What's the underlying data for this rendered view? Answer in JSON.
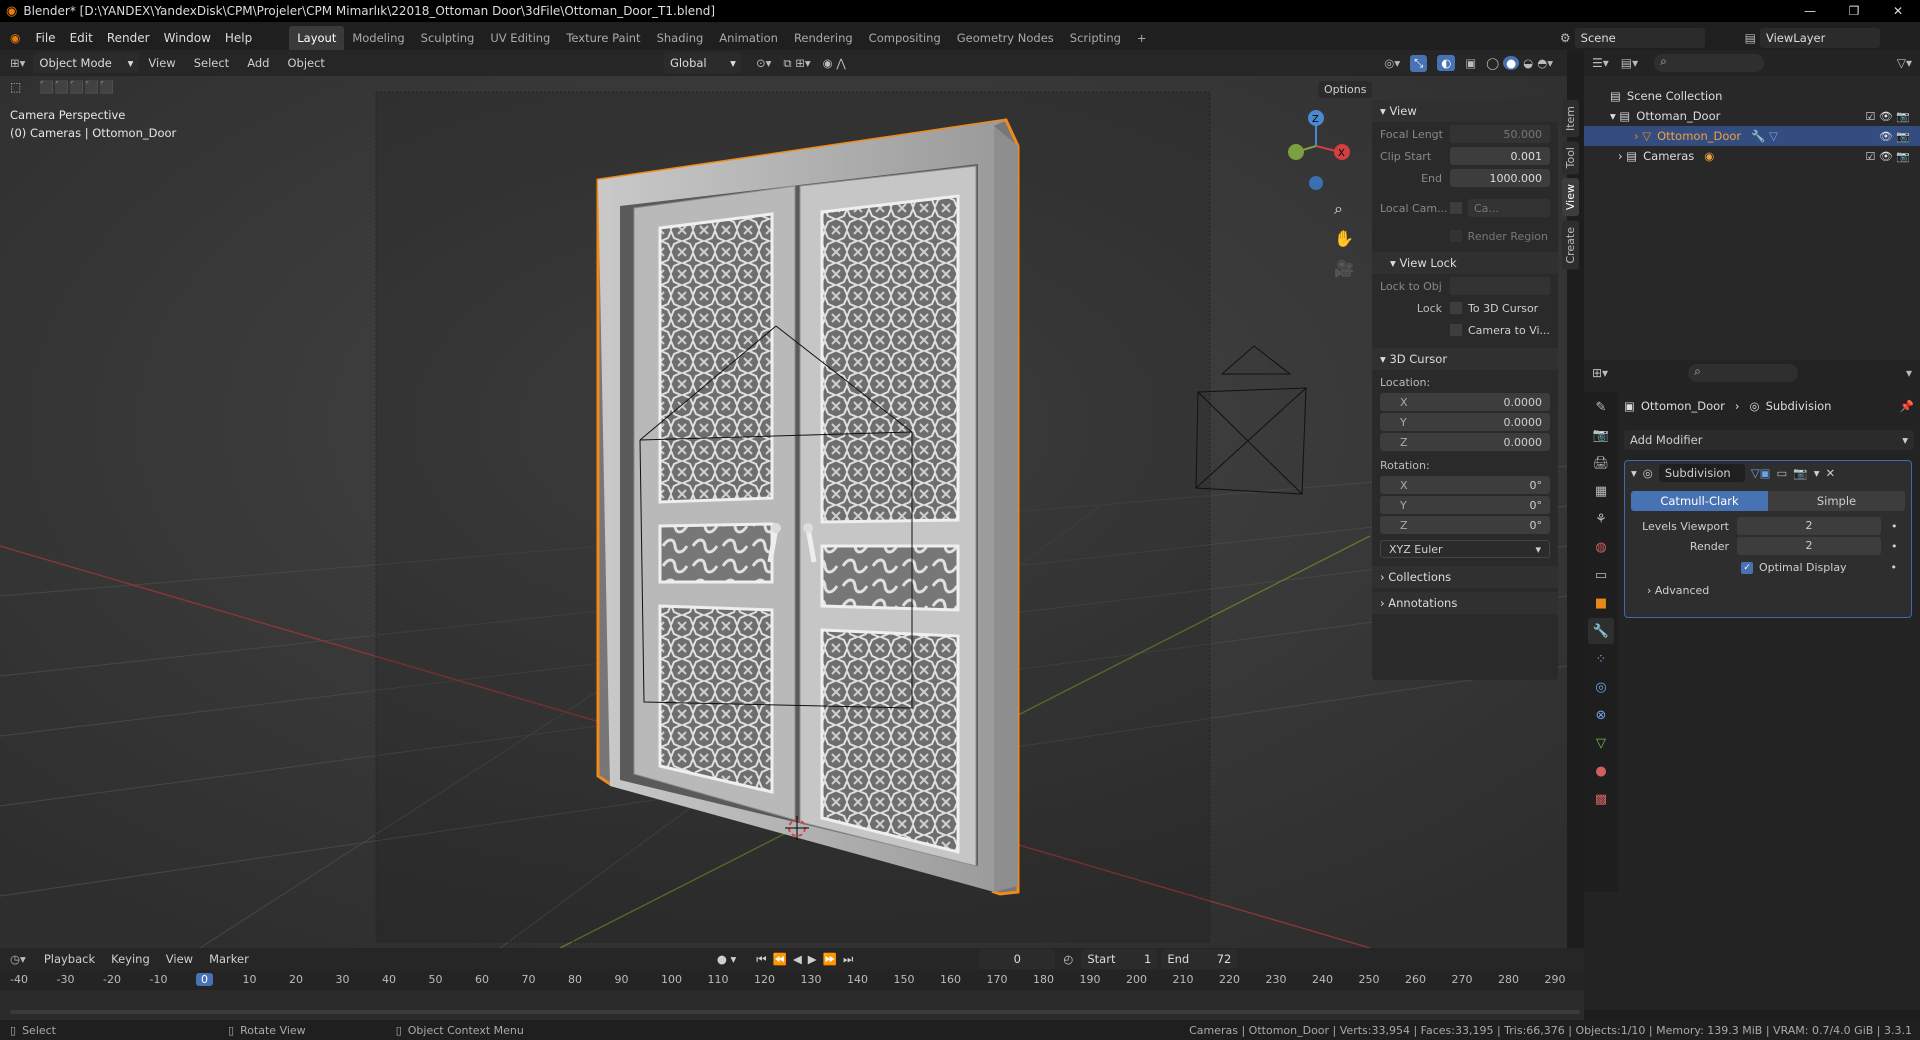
{
  "title": "Blender* [D:\\YANDEX\\YandexDisk\\CPM\\Projeler\\CPM Mimarlık\\22018_Ottoman Door\\3dFile\\Ottoman_Door_T1.blend]",
  "window_controls": [
    "—",
    "❐",
    "✕"
  ],
  "menus": [
    "File",
    "Edit",
    "Render",
    "Window",
    "Help"
  ],
  "workspaces": [
    "Layout",
    "Modeling",
    "Sculpting",
    "UV Editing",
    "Texture Paint",
    "Shading",
    "Animation",
    "Rendering",
    "Compositing",
    "Geometry Nodes",
    "Scripting",
    "+"
  ],
  "scene": "Scene",
  "view_layer": "ViewLayer",
  "viewport_header": {
    "mode": "Object Mode",
    "menus": [
      "View",
      "Select",
      "Add",
      "Object"
    ],
    "orientation": "Global",
    "options": "Options"
  },
  "viewport_overlay": {
    "line1": "Camera Perspective",
    "line2": "(0) Cameras | Ottomon_Door"
  },
  "npanel": {
    "tabs": [
      "Item",
      "Tool",
      "View",
      "Create"
    ],
    "view_header": "View",
    "focal_label": "Focal Lengt",
    "focal_value": "50.000",
    "clip_start_label": "Clip Start",
    "clip_start_value": "0.001",
    "end_label": "End",
    "end_value": "1000.000",
    "local_cam_label": "Local Cam...",
    "local_cam_value": "Ca...",
    "render_region": "Render Region",
    "view_lock_header": "View Lock",
    "lock_to_obj": "Lock to Obj",
    "lock_label": "Lock",
    "to_3d_cursor": "To 3D Cursor",
    "camera_to_view": "Camera to Vi...",
    "cursor_header": "3D Cursor",
    "location_label": "Location:",
    "loc": [
      {
        "k": "X",
        "v": "0.0000"
      },
      {
        "k": "Y",
        "v": "0.0000"
      },
      {
        "k": "Z",
        "v": "0.0000"
      }
    ],
    "rotation_label": "Rotation:",
    "rot": [
      {
        "k": "X",
        "v": "0°"
      },
      {
        "k": "Y",
        "v": "0°"
      },
      {
        "k": "Z",
        "v": "0°"
      }
    ],
    "euler": "XYZ Euler",
    "collections": "Collections",
    "annotations": "Annotations"
  },
  "outliner": {
    "scene_collection": "Scene Collection",
    "items": [
      "Ottoman_Door",
      "Ottomon_Door",
      "Cameras"
    ]
  },
  "properties": {
    "breadcrumb_obj": "Ottomon_Door",
    "breadcrumb_mod": "Subdivision",
    "add_modifier": "Add Modifier",
    "modifier_name": "Subdivision",
    "catmull": "Catmull-Clark",
    "simple": "Simple",
    "levels_viewport_label": "Levels Viewport",
    "levels_viewport_value": "2",
    "render_label": "Render",
    "render_value": "2",
    "optimal_display": "Optimal Display",
    "advanced": "Advanced"
  },
  "timeline": {
    "menus": [
      "Playback",
      "Keying",
      "View",
      "Marker"
    ],
    "current_frame": "0",
    "start_label": "Start",
    "start_value": "1",
    "end_label": "End",
    "end_value": "72",
    "ticks": [
      "-40",
      "-30",
      "-20",
      "-10",
      "0",
      "10",
      "20",
      "30",
      "40",
      "50",
      "60",
      "70",
      "80",
      "90",
      "100",
      "110",
      "120",
      "130",
      "140",
      "150",
      "160",
      "170",
      "180",
      "190",
      "200",
      "210",
      "220",
      "230",
      "240",
      "250",
      "260",
      "270",
      "280",
      "290"
    ]
  },
  "status": {
    "select": "Select",
    "rotate": "Rotate View",
    "context": "Object Context Menu",
    "stats": "Cameras | Ottomon_Door | Verts:33,954 | Faces:33,195 | Tris:66,376 | Objects:1/10 | Memory: 139.3 MiB | VRAM: 0.7/4.0 GiB | 3.3.1"
  },
  "colors": {
    "accent": "#4772b3",
    "selection": "#e8881a",
    "bg": "#3c3c3c"
  }
}
